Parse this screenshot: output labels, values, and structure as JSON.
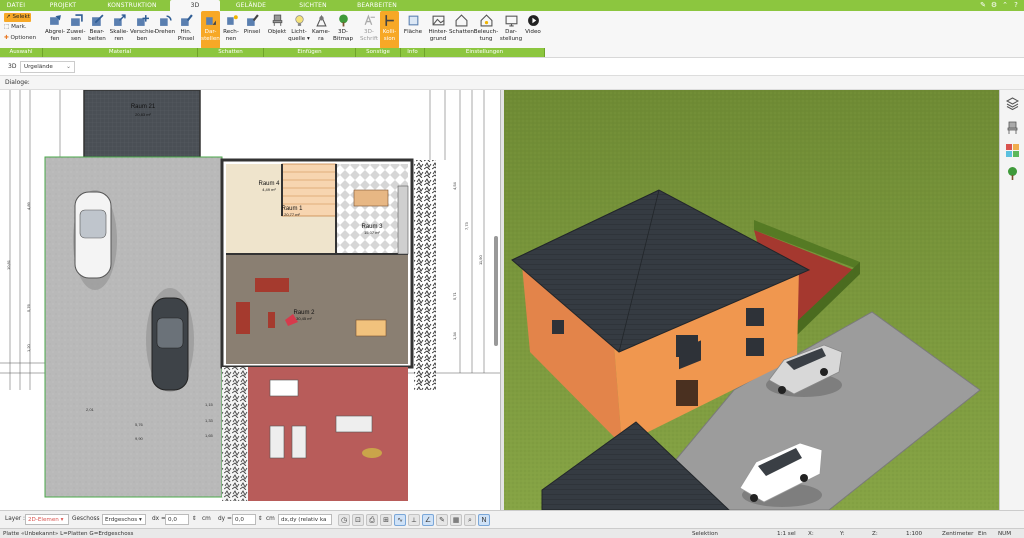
{
  "menu_tabs": [
    "DATEI",
    "PROJEKT",
    "KONSTRUKTION",
    "3D",
    "GELÄNDE",
    "SICHTEN",
    "BEARBEITEN"
  ],
  "active_tab": "3D",
  "ribbon": {
    "auswahl": {
      "selekt": "Selekt",
      "mark": "Mark.",
      "optionen": "Optionen",
      "group": "Auswahl"
    },
    "material": {
      "group": "Material",
      "items": [
        [
          "Abgrei-",
          "fen"
        ],
        [
          "Zuwei-",
          "sen"
        ],
        [
          "Bear-",
          "beiten"
        ],
        [
          "Skalie-",
          "ren"
        ],
        [
          "Verschie-",
          "ben"
        ],
        [
          "Drehen",
          ""
        ],
        [
          "Hin.",
          "Pinsel"
        ]
      ]
    },
    "schatten": {
      "group": "Schatten",
      "items": [
        [
          "Dar-",
          "stellen"
        ],
        [
          "Rech-",
          "nen"
        ],
        [
          "Pinsel",
          ""
        ]
      ]
    },
    "einfuegen": {
      "group": "Einfügen",
      "items": [
        [
          "Objekt",
          ""
        ],
        [
          "Licht-",
          "quelle"
        ],
        [
          "Kame-",
          "ra"
        ],
        [
          "3D-",
          "Bitmap"
        ]
      ]
    },
    "sonstige": {
      "group": "Sonstige",
      "items": [
        [
          "3D-",
          "Schrift"
        ],
        [
          "Kolli-",
          "sion"
        ]
      ]
    },
    "info": {
      "group": "Info",
      "items": [
        [
          "Fläche",
          ""
        ]
      ]
    },
    "einstellungen": {
      "group": "Einstellungen",
      "items": [
        [
          "Hinter-",
          "grund"
        ],
        [
          "Schatten",
          ""
        ],
        [
          "Beleuch-",
          "tung"
        ],
        [
          "Dar-",
          "stellung"
        ],
        [
          "Video",
          ""
        ]
      ]
    }
  },
  "view_bar": {
    "label": "3D",
    "layer_select": "Urgelände"
  },
  "dialog_label": "Dialoge:",
  "plan": {
    "rooms": [
      {
        "name": "Raum 21",
        "area": "20,83 m²"
      },
      {
        "name": "Raum 4",
        "area": "4,49 m²"
      },
      {
        "name": "Raum 1",
        "area": "20,77 m²"
      },
      {
        "name": "Raum 3",
        "area": "15,07 m²"
      },
      {
        "name": "Raum 2",
        "area": "30,45 m²"
      }
    ],
    "dims_left": [
      "4,89",
      "10,81",
      "5,76",
      "1,20"
    ],
    "dims_right": [
      "7,73",
      "11,90",
      "4,54",
      "5,71",
      "1,34"
    ],
    "dims_bottom": [
      "2,01",
      "5,76",
      "9,90",
      "1,15",
      "1,33",
      "1,65"
    ]
  },
  "bottom_bar": {
    "layer_label": "Layer :",
    "layer_value": "2D-Elemen",
    "geschoss_label": "Geschoss :",
    "geschoss_value": "Erdgeschos",
    "dx_label": "dx =",
    "dx_value": "0,0",
    "dx_unit": "cm",
    "dy_label": "dy =",
    "dy_value": "0,0",
    "dy_unit": "cm",
    "mode_value": "dx,dy (relativ ka"
  },
  "status_bar": {
    "left": "Platte «Unbekannt» L=Platten G=Erdgeschoss",
    "selektion": "Selektion",
    "sel_count": "1:1 sel",
    "x": "X:",
    "y": "Y:",
    "z": "Z:",
    "scale": "1:100",
    "unit": "Zentimeter",
    "ein": "Ein",
    "num": "NUM"
  },
  "colors": {
    "accent_green": "#8cc63f",
    "active_orange": "#f7a826",
    "grass": "#78923a",
    "roof": "#3a4048",
    "wall": "#e8884a"
  }
}
